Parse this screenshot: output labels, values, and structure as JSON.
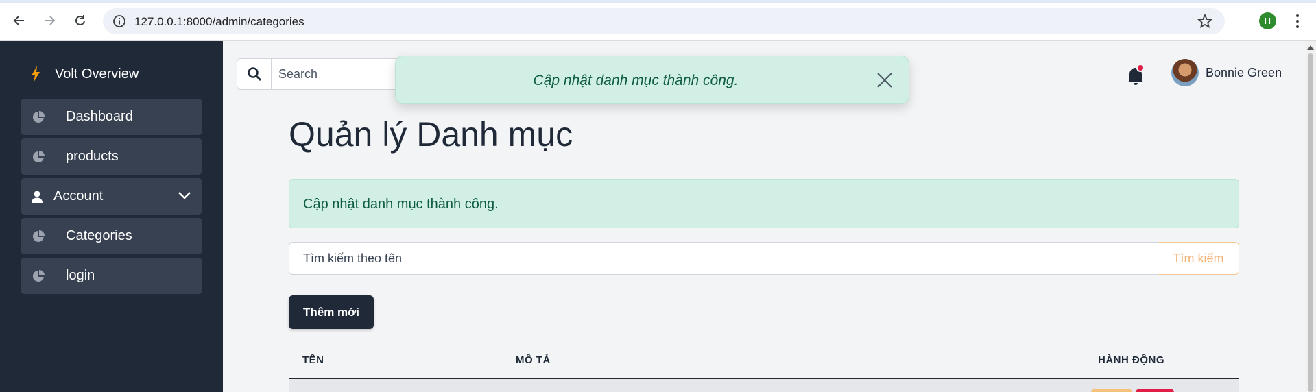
{
  "browser": {
    "url": "127.0.0.1:8000/admin/categories",
    "profile_initial": "H"
  },
  "sidebar": {
    "brand": "Volt Overview",
    "items": [
      {
        "label": "Dashboard",
        "icon": "pie-chart-icon"
      },
      {
        "label": "products",
        "icon": "pie-chart-icon"
      },
      {
        "label": "Account",
        "icon": "user-icon",
        "expandable": true
      },
      {
        "label": "Categories",
        "icon": "pie-chart-icon"
      },
      {
        "label": "login",
        "icon": "pie-chart-icon"
      }
    ]
  },
  "topbar": {
    "search_placeholder": "Search",
    "user_name": "Bonnie Green"
  },
  "toast": {
    "message": "Cập nhật danh mục thành công."
  },
  "main": {
    "title": "Quản lý Danh mục",
    "alert": "Cập nhật danh mục thành công.",
    "filter_placeholder": "Tìm kiếm theo tên",
    "filter_button": "Tìm kiếm",
    "add_button": "Thêm mới",
    "table": {
      "headers": [
        "TÊN",
        "MÔ TẢ",
        "HÀNH ĐỘNG"
      ]
    }
  },
  "colors": {
    "sidebar_bg": "#1f2937",
    "sidebar_item_bg": "#374151",
    "success_bg": "#d1efe4",
    "success_text": "#0f5c45",
    "warning": "#f5c27a",
    "danger": "#e11d48"
  }
}
